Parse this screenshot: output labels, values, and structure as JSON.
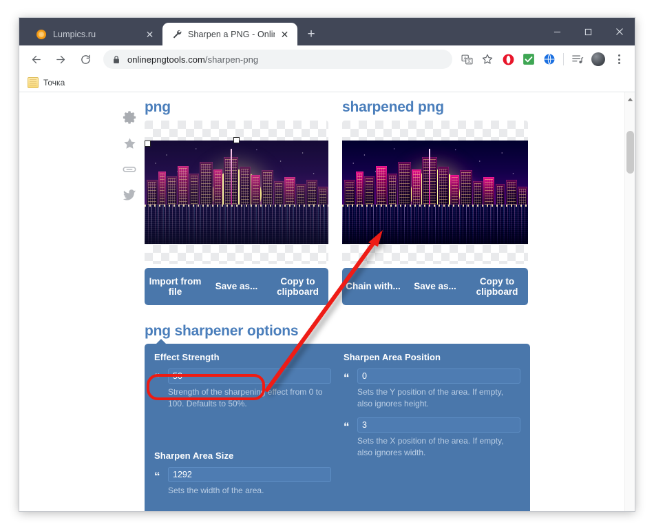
{
  "browser": {
    "tabs": [
      {
        "title": "Lumpics.ru",
        "favicon": "orange-dot-icon",
        "active": false,
        "close_label": "✕"
      },
      {
        "title": "Sharpen a PNG - Online PNG Too",
        "favicon": "wrench-icon",
        "active": true,
        "close_label": "✕"
      }
    ],
    "new_tab_label": "+",
    "window_controls": {
      "minimize": "—",
      "maximize": "☐",
      "close": "✕"
    },
    "nav": {
      "back": "←",
      "forward": "→",
      "reload": "↻"
    },
    "omnibox": {
      "url_main": "onlinepngtools.com",
      "url_path": "/sharpen-png",
      "security_icon": "lock-icon"
    },
    "toolbar_icons": [
      "translate-icon",
      "bookmark-star-icon",
      "opera-adblock-icon",
      "green-check-icon",
      "blue-globe-icon",
      "reading-list-icon",
      "profile-avatar-icon",
      "chrome-menu-icon"
    ],
    "bookmarks": [
      {
        "label": "Точка",
        "icon": "bookmark-folder-icon"
      }
    ]
  },
  "page": {
    "social_rail": [
      "gear-icon",
      "star-icon",
      "link-icon",
      "twitter-icon"
    ],
    "left_panel": {
      "title": "png",
      "buttons": [
        "Import from file",
        "Save as...",
        "Copy to clipboard"
      ]
    },
    "right_panel": {
      "title": "sharpened png",
      "buttons": [
        "Chain with...",
        "Save as...",
        "Copy to clipboard"
      ]
    },
    "options": {
      "title": "png sharpener options",
      "groups": [
        {
          "label": "Effect Strength",
          "fields": [
            {
              "value": "50",
              "hint": "Strength of the sharpening effect from 0 to 100. Defaults to 50%."
            }
          ]
        },
        {
          "label": "Sharpen Area Position",
          "fields": [
            {
              "value": "0",
              "hint": "Sets the Y position of the area. If empty, also ignores height."
            },
            {
              "value": "3",
              "hint": "Sets the X position of the area. If empty, also ignores width."
            }
          ]
        },
        {
          "label": "Sharpen Area Size",
          "fields": [
            {
              "value": "1292",
              "hint": "Sets the width of the area."
            }
          ]
        }
      ]
    }
  },
  "annotation": {
    "highlight_color": "#ee1b12",
    "arrow_from": "effect-strength-field",
    "arrow_to": "sharpened-image"
  },
  "colors": {
    "accent_blue": "#4a7ebb",
    "panel_blue": "#4a77ab",
    "titlebar": "#414757",
    "annotation_red": "#ee1b12"
  }
}
